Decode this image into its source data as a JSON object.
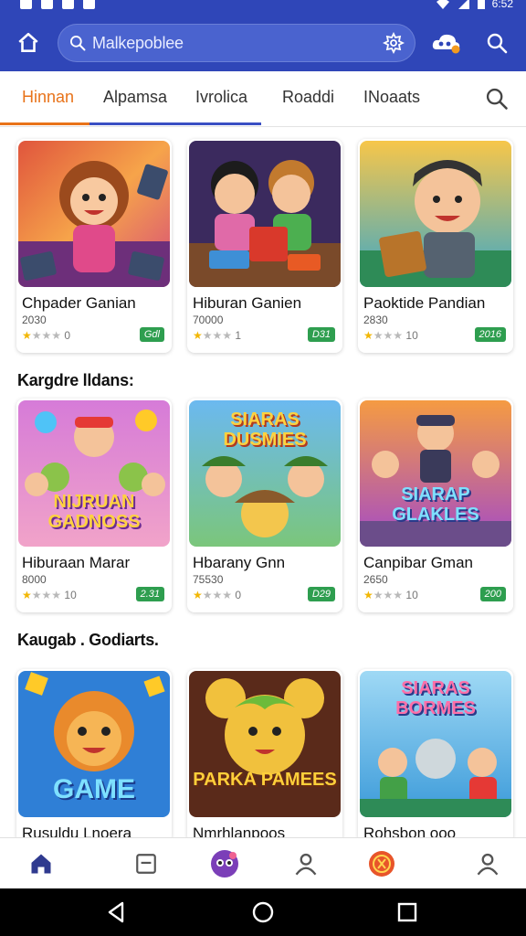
{
  "status_bar": {
    "time": "6:52"
  },
  "search": {
    "placeholder": "Malkepoblee"
  },
  "tabs": [
    {
      "label": "Hinnan",
      "active": true
    },
    {
      "label": "Alpamsa",
      "active": false
    },
    {
      "label": "Ivrolica",
      "active": false
    },
    {
      "label": "Roaddi",
      "active": false
    },
    {
      "label": "INoaats",
      "active": false
    }
  ],
  "sections": [
    {
      "title": ""
    },
    {
      "title": "Kargdre lldans:"
    },
    {
      "title": "Kaugab . Godiarts."
    }
  ],
  "cards": [
    {
      "title": "Chpader Ganian",
      "sub": "2030",
      "rating": "0",
      "badge": "Gdl"
    },
    {
      "title": "Hiburan Ganien",
      "sub": "70000",
      "rating": "1",
      "badge": "D31"
    },
    {
      "title": "Paoktide Pandian",
      "sub": "2830",
      "rating": "10",
      "badge": "2016"
    },
    {
      "title": "Hiburaan Marar",
      "sub": "8000",
      "rating": "10",
      "badge": "2.31"
    },
    {
      "title": "Hbarany Gnn",
      "sub": "75530",
      "rating": "0",
      "badge": "D29"
    },
    {
      "title": "Canpibar Gman",
      "sub": "2650",
      "rating": "10",
      "badge": "200"
    },
    {
      "title": "Rusuldu Lnoera",
      "sub": "",
      "rating": "",
      "badge": ""
    },
    {
      "title": "Nmrhlanpoos",
      "sub": "",
      "rating": "",
      "badge": ""
    },
    {
      "title": "Rohsbon ooo",
      "sub": "",
      "rating": "",
      "badge": ""
    }
  ],
  "thumb_text": {
    "t4": "NIJRUAN GADNOSS",
    "t5": "SIARAS DUSMIES",
    "t6": "SIARAP GLAKLES",
    "t7": "GAME",
    "t8": "PARKA PAMEES",
    "t9": "SIARAS BORMES"
  },
  "colors": {
    "primary": "#2f46b8",
    "accent": "#e8731a",
    "badge": "#2e9e4f"
  }
}
